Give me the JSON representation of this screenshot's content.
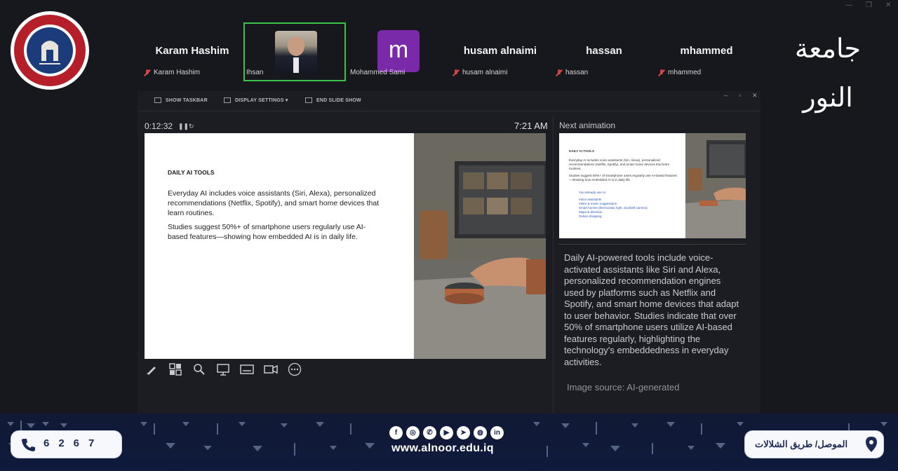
{
  "participants": [
    {
      "display": "Karam Hashim",
      "tag": "Karam Hashim",
      "muted": true
    },
    {
      "display": "",
      "tag": "Ihsan",
      "muted": false,
      "video": true
    },
    {
      "display": "m",
      "tag": "Mohammed Sami",
      "muted": false
    },
    {
      "display": "husam alnaimi",
      "tag": "husam alnaimi",
      "muted": true
    },
    {
      "display": "hassan",
      "tag": "hassan",
      "muted": true
    },
    {
      "display": "mhammed",
      "tag": "mhammed",
      "muted": true
    }
  ],
  "branding": {
    "logo_text": "ALNOOR UNIVERSITY",
    "wordmark": "جامعة النور"
  },
  "presenter": {
    "toolbar": [
      "SHOW TASKBAR",
      "DISPLAY SETTINGS ▾",
      "END SLIDE SHOW"
    ],
    "elapsed": "0:12:32",
    "clock": "7:21 AM",
    "next_label": "Next animation",
    "slide": {
      "title": "DAILY AI TOOLS",
      "para1": "Everyday AI includes voice assistants (Siri, Alexa), personalized recommendations (Netflix, Spotify), and smart home devices that learn routines.",
      "para2": "Studies suggest 50%+ of smartphone users regularly use AI-based features—showing how embedded AI is in daily life."
    },
    "next_slide": {
      "title": "DAILY AI TOOLS",
      "para1": "Everyday AI includes voice assistants (Siri, Alexa), personalized recommendations (Netflix, Spotify), and smart home devices that learn routines.",
      "para2": "Studies suggest 50%+ of smartphone users regularly use AI-based features—showing how embedded AI is in daily life.",
      "list_head": "You already use AI",
      "list": [
        "Voice assistants",
        "Video & music suggestions",
        "Smart homes (thermostat, light, doorbell camera)",
        "Maps & direction",
        "Online shopping"
      ]
    },
    "notes": "Daily AI-powered tools include voice-activated assistants like Siri and Alexa, personalized recommendation engines used by platforms such as Netflix and Spotify, and smart home devices that adapt to user behavior. Studies indicate that over 50% of smartphone users utilize AI-based features regularly, highlighting the technology's embeddedness in everyday activities.",
    "image_source": "Image source: AI-generated"
  },
  "footer": {
    "phone": "6267",
    "website": "www.alnoor.edu.iq",
    "address": "الموصل/ طريق الشلالات",
    "social": [
      "f",
      "◎",
      "✆",
      "▶",
      "➤",
      "◍",
      "in"
    ]
  },
  "colors": {
    "background": "#16181d",
    "active_speaker": "#3cc24b",
    "avatar_m": "#7a2aa8",
    "brand_navy": "#1d2a56"
  }
}
